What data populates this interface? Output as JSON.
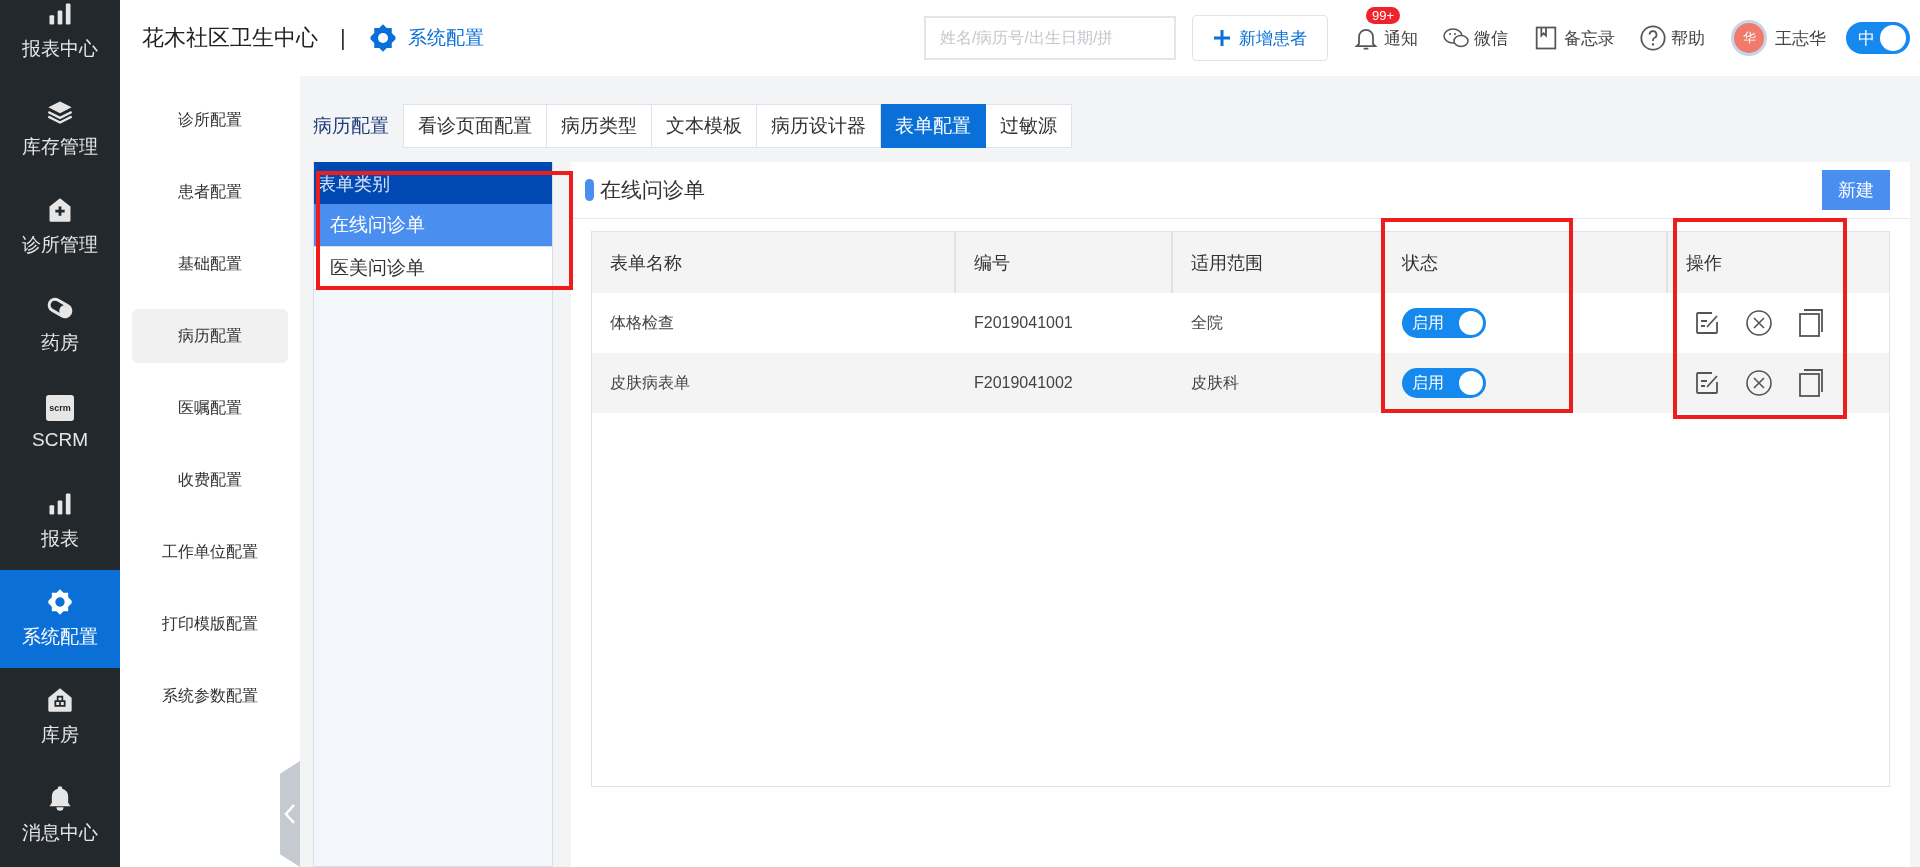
{
  "nav": {
    "items": [
      {
        "label": "报表中心",
        "kind": "bars",
        "selected": false
      },
      {
        "label": "库存管理",
        "kind": "layers",
        "selected": false
      },
      {
        "label": "诊所管理",
        "kind": "plus",
        "selected": false
      },
      {
        "label": "药房",
        "kind": "pill",
        "selected": false
      },
      {
        "label": "SCRM",
        "kind": "scrm",
        "icon_text": "scrm",
        "selected": false
      },
      {
        "label": "报表",
        "kind": "bars",
        "selected": false
      },
      {
        "label": "系统配置",
        "kind": "gear",
        "selected": true
      },
      {
        "label": "库房",
        "kind": "house",
        "selected": false
      },
      {
        "label": "消息中心",
        "kind": "bell",
        "selected": false
      }
    ]
  },
  "header": {
    "clinic": "花木社区卫生中心",
    "separator": "|",
    "module": "系统配置",
    "search": {
      "placeholder": "姓名/病历号/出生日期/拼"
    },
    "new_patient": "新增患者",
    "actions": [
      {
        "kind": "bell",
        "label": "通知",
        "badge": "99+"
      },
      {
        "kind": "wechat",
        "label": "微信"
      },
      {
        "kind": "book",
        "label": "备忘录"
      },
      {
        "kind": "help",
        "label": "帮助"
      }
    ],
    "user": {
      "avatar": "华",
      "name": "王志华"
    },
    "language_toggle": {
      "label": "中",
      "on": true
    }
  },
  "submenu": {
    "items": [
      {
        "label": "诊所配置",
        "selected": false
      },
      {
        "label": "患者配置",
        "selected": false
      },
      {
        "label": "基础配置",
        "selected": false
      },
      {
        "label": "病历配置",
        "selected": true
      },
      {
        "label": "医嘱配置",
        "selected": false
      },
      {
        "label": "收费配置",
        "selected": false
      },
      {
        "label": "工作单位配置",
        "selected": false
      },
      {
        "label": "打印模版配置",
        "selected": false
      },
      {
        "label": "系统参数配置",
        "selected": false
      }
    ]
  },
  "tabs": {
    "section": "病历配置",
    "items": [
      {
        "label": "看诊页面配置",
        "selected": false
      },
      {
        "label": "病历类型",
        "selected": false
      },
      {
        "label": "文本模板",
        "selected": false
      },
      {
        "label": "病历设计器",
        "selected": false
      },
      {
        "label": "表单配置",
        "selected": true
      },
      {
        "label": "过敏源",
        "selected": false
      }
    ]
  },
  "categories": {
    "title": "表单类别",
    "items": [
      {
        "label": "在线问诊单",
        "selected": true
      },
      {
        "label": "医美问诊单",
        "selected": false
      }
    ]
  },
  "form_list": {
    "title": "在线问诊单",
    "new_button": "新建",
    "columns": [
      "表单名称",
      "编号",
      "适用范围",
      "状态",
      "操作"
    ],
    "rows": [
      {
        "name": "体格检查",
        "code": "F2019041001",
        "scope": "全院",
        "status": {
          "label": "启用",
          "on": true
        }
      },
      {
        "name": "皮肤病表单",
        "code": "F2019041002",
        "scope": "皮肤科",
        "status": {
          "label": "启用",
          "on": true
        }
      }
    ]
  },
  "annotations": [
    {
      "kind": "frame"
    },
    {
      "kind": "frame"
    },
    {
      "kind": "frame"
    }
  ]
}
